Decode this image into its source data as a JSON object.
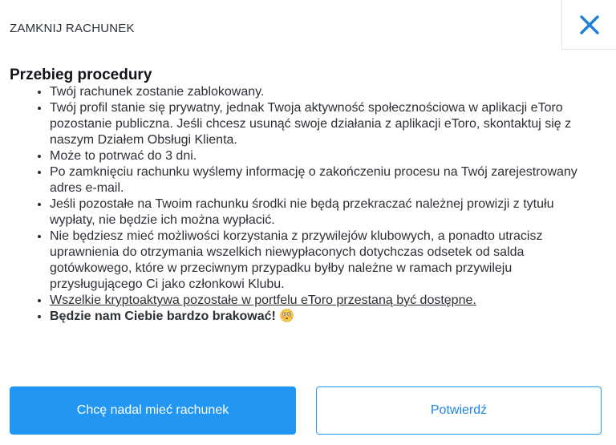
{
  "header": {
    "title": "ZAMKNIJ RACHUNEK",
    "close_icon": "close-icon",
    "close_color": "#1f7fd6"
  },
  "content": {
    "section_title": "Przebieg procedury",
    "items": [
      "Twój rachunek zostanie zablokowany.",
      "Twój profil stanie się prywatny, jednak Twoja aktywność społecznościowa w aplikacji eToro pozostanie publiczna. Jeśli chcesz usunąć swoje działania z aplikacji eToro, skontaktuj się z naszym Działem Obsługi Klienta.",
      "Może to potrwać do 3 dni.",
      "Po zamknięciu rachunku wyślemy informację o zakończeniu procesu na Twój zarejestrowany adres e-mail.",
      "Jeśli pozostałe na Twoim rachunku środki nie będą przekraczać należnej prowizji z tytułu wypłaty, nie będzie ich można wypłacić.",
      "Nie będziesz mieć możliwości korzystania z przywilejów klubowych, a ponadto utracisz uprawnienia do otrzymania wszelkich niewypłaconych dotychczas odsetek od salda gotówkowego, które w przeciwnym przypadku byłby należne w ramach przywileju przysługującego Ci jako członkowi Klubu.",
      "Wszelkie kryptoaktywa pozostałe w portfelu eToro przestaną być dostępne.",
      "Będzie nam Ciebie bardzo brakować!"
    ],
    "last_item_emoji": "flushed-face-icon"
  },
  "buttons": {
    "keep_label": "Chcę nadal mieć rachunek",
    "confirm_label": "Potwierdź",
    "accent_color": "#2196f3"
  }
}
